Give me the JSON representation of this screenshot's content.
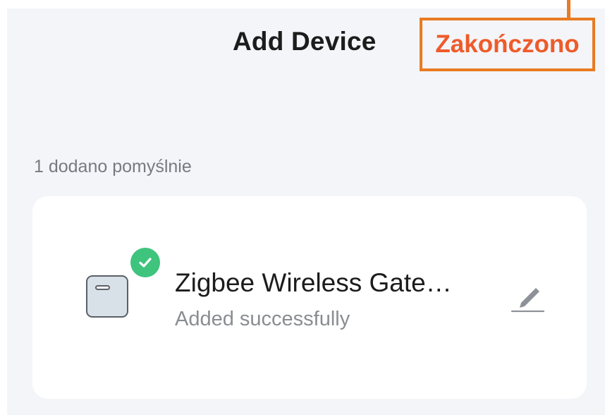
{
  "header": {
    "title": "Add Device",
    "done_label": "Zakończono"
  },
  "section": {
    "label": "1 dodano pomyślnie"
  },
  "device": {
    "name": "Zigbee Wireless Gate…",
    "status": "Added successfully"
  },
  "icons": {
    "device": "gateway-device-icon",
    "badge": "check-icon",
    "edit": "pencil-icon"
  },
  "colors": {
    "accent": "#ee5b2b",
    "highlight_border": "#e97b22",
    "success": "#3ec47d",
    "background": "#f4f5f8",
    "card": "#ffffff"
  }
}
